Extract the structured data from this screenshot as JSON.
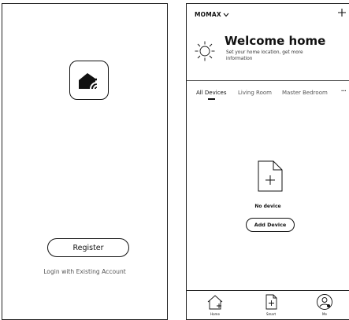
{
  "login": {
    "register_label": "Register",
    "login_link": "Login with Existing Account",
    "logo_icon": "home-wifi-icon"
  },
  "home": {
    "home_name": "MOMAX",
    "welcome_title": "Welcome home",
    "welcome_subtitle": "Set your home location, get more information",
    "weather_icon": "sun-icon",
    "tabs": [
      {
        "label": "All Devices",
        "active": true
      },
      {
        "label": "Living Room",
        "active": false
      },
      {
        "label": "Master Bedroom",
        "active": false
      }
    ],
    "more_label": "···",
    "empty_text": "No device",
    "add_device_label": "Add Device"
  },
  "nav": {
    "items": [
      {
        "label": "Home",
        "icon": "home-icon"
      },
      {
        "label": "Smart",
        "icon": "smart-icon"
      },
      {
        "label": "Me",
        "icon": "profile-icon"
      }
    ]
  }
}
